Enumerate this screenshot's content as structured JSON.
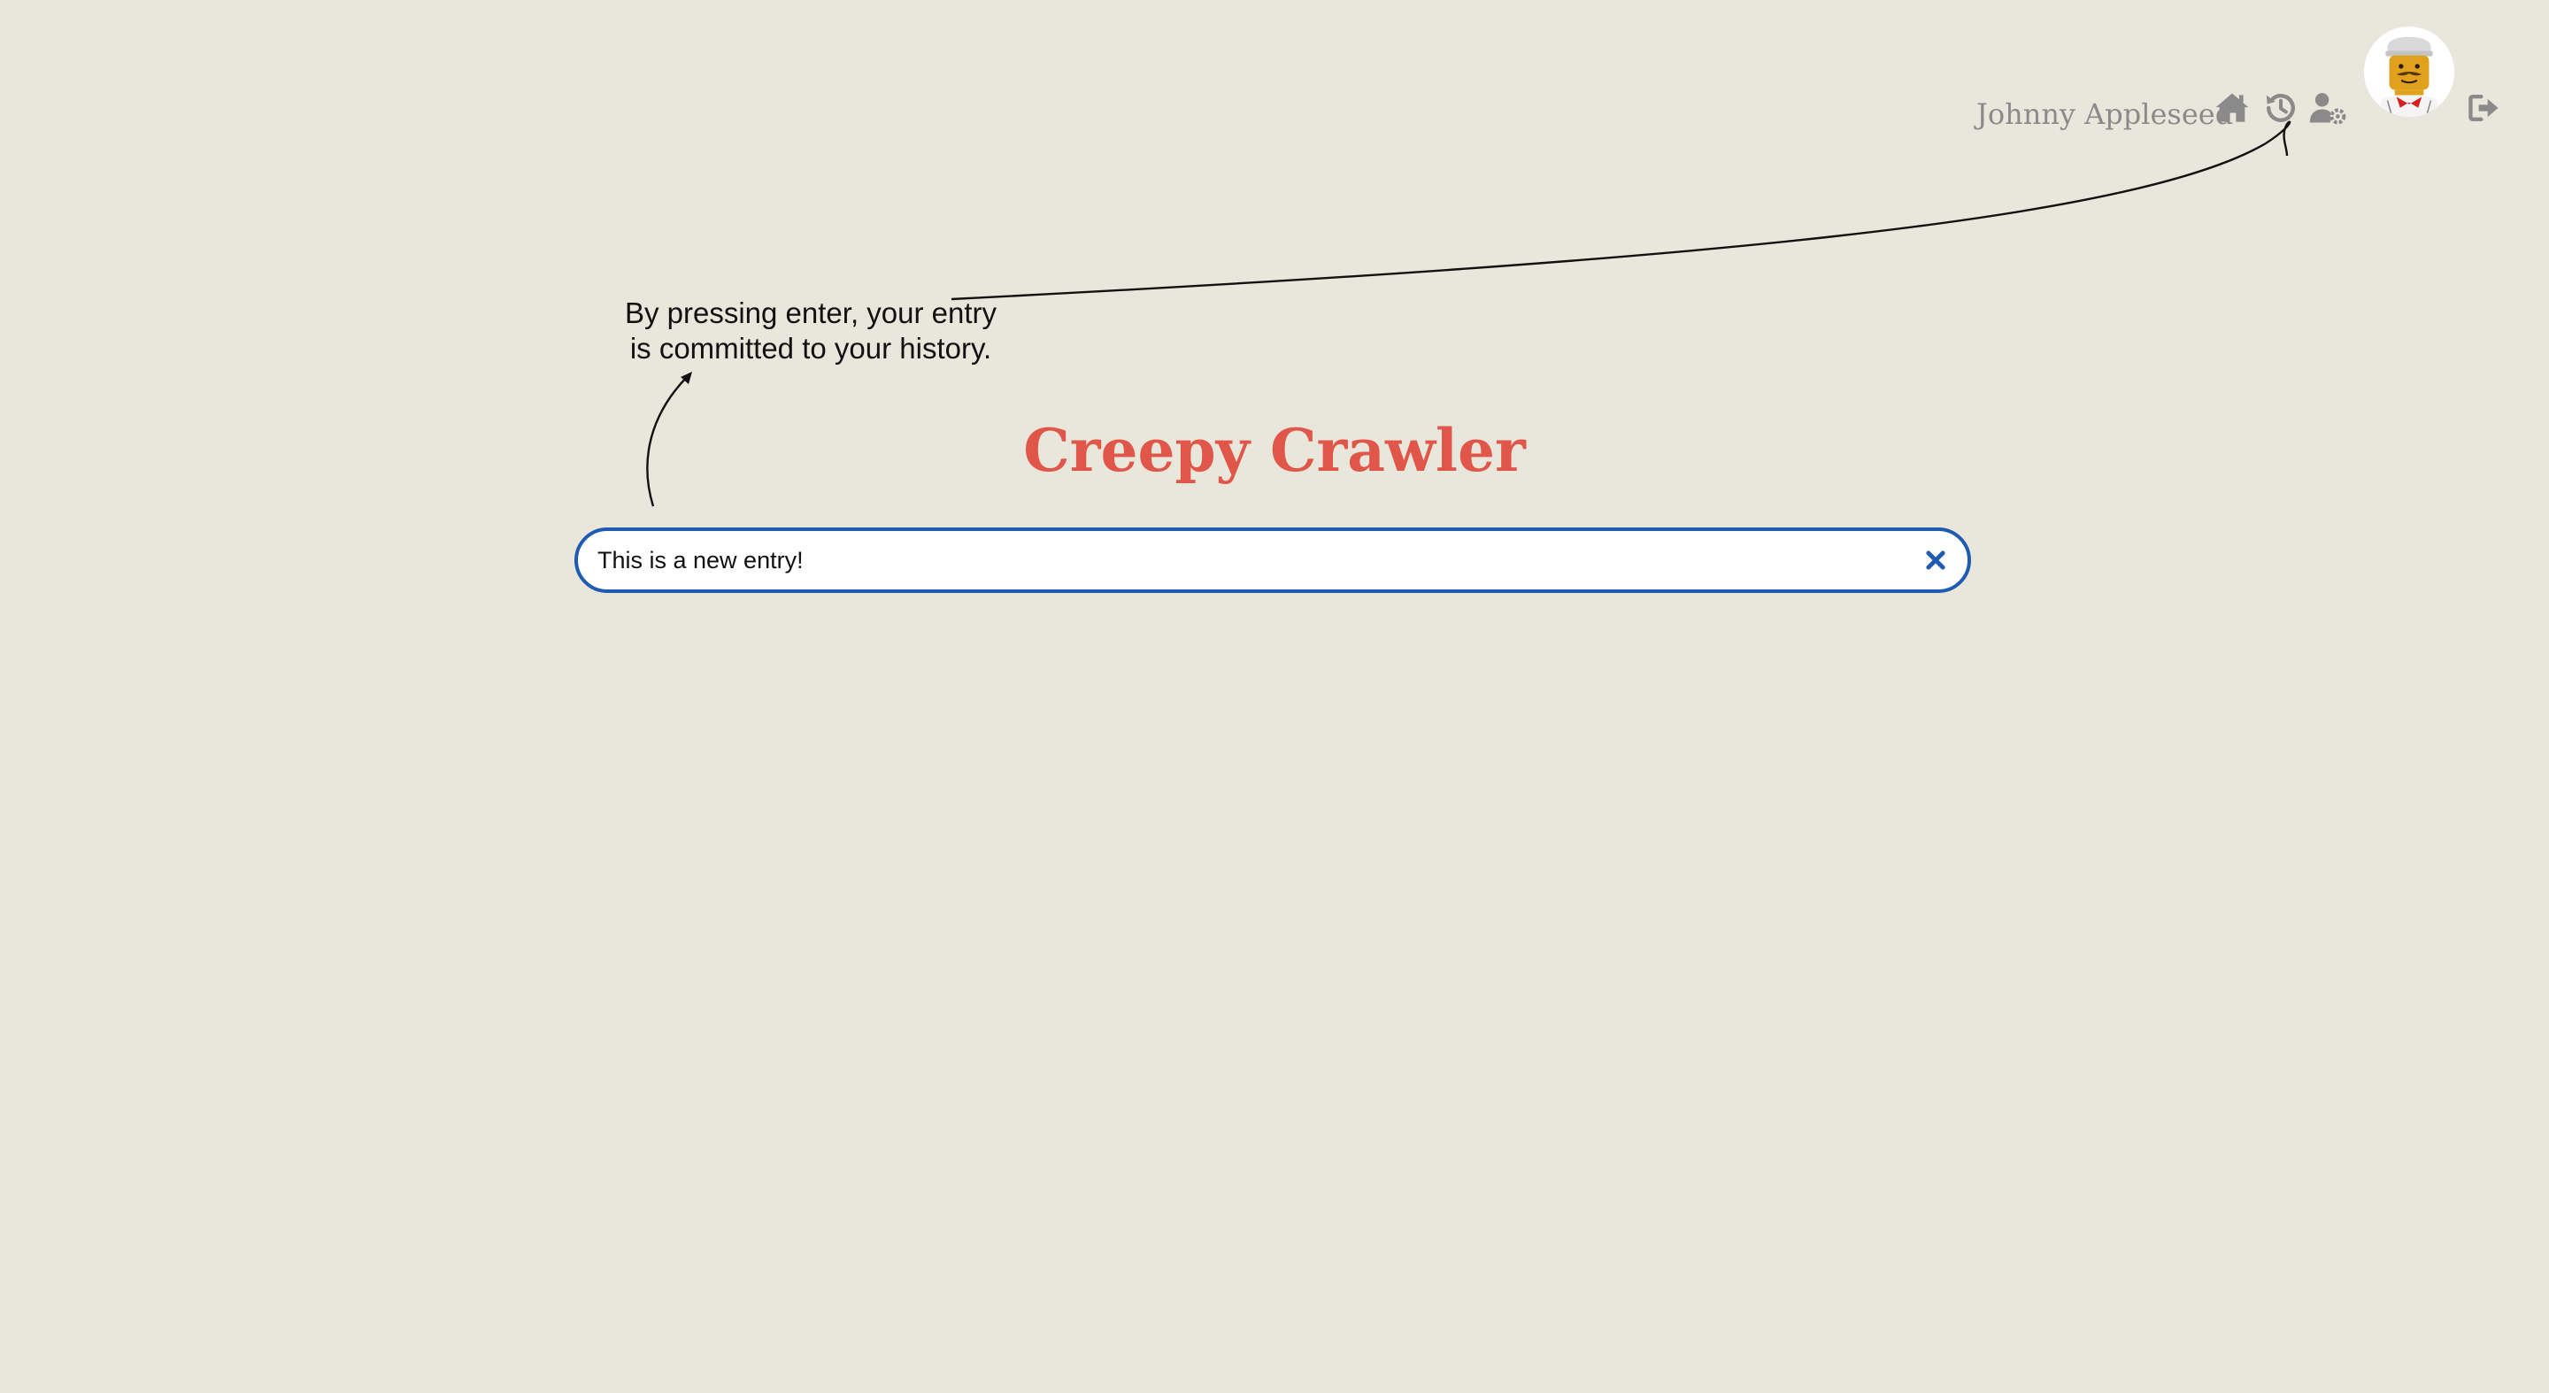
{
  "header": {
    "username": "Johnny Appleseed",
    "icons": {
      "home": "home-icon",
      "history": "history-icon",
      "user_settings": "user-settings-icon",
      "logout": "logout-icon"
    },
    "avatar": "lego-minifigure-avatar"
  },
  "annotation": {
    "text": "By pressing enter, your entry is committed to your history."
  },
  "main": {
    "title": "Creepy Crawler",
    "entry": {
      "value": "This is a new entry!",
      "clear_icon": "close-icon"
    }
  },
  "colors": {
    "background": "#e9e6dc",
    "title": "#e0574a",
    "input_border": "#1f5bb0",
    "icon": "#8a8a8a"
  }
}
